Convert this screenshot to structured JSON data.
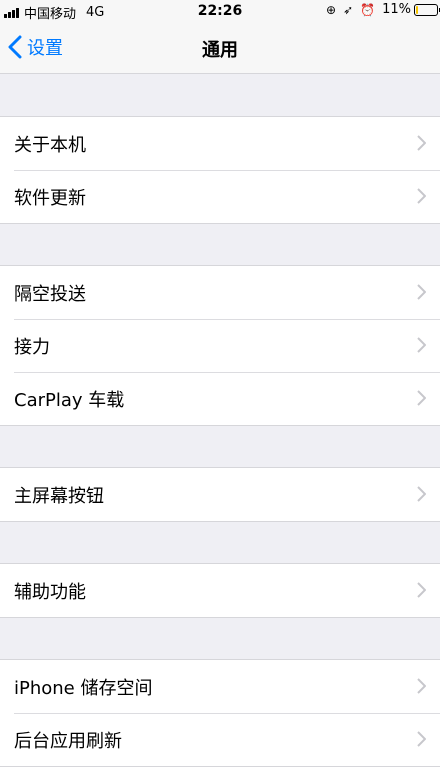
{
  "status_bar": {
    "carrier": "中国移动",
    "network": "4G",
    "time": "22:26",
    "battery_percent": "11%",
    "battery_level": 0.11,
    "battery_color": "#f7c500"
  },
  "nav": {
    "back_label": "设置",
    "title": "通用",
    "accent": "#007aff"
  },
  "groups": [
    {
      "items": [
        {
          "label": "关于本机"
        },
        {
          "label": "软件更新"
        }
      ]
    },
    {
      "items": [
        {
          "label": "隔空投送"
        },
        {
          "label": "接力"
        },
        {
          "label": "CarPlay 车载"
        }
      ]
    },
    {
      "items": [
        {
          "label": "主屏幕按钮"
        }
      ]
    },
    {
      "items": [
        {
          "label": "辅助功能"
        }
      ]
    },
    {
      "items": [
        {
          "label": "iPhone 储存空间"
        },
        {
          "label": "后台应用刷新"
        }
      ]
    }
  ]
}
